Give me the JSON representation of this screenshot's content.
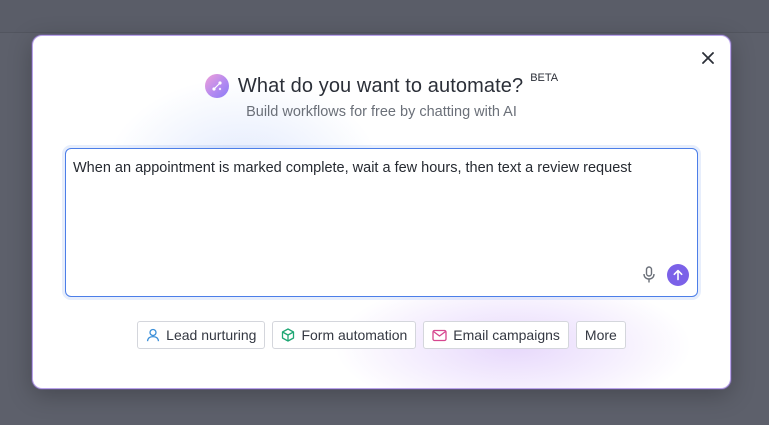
{
  "dialog": {
    "title": "What do you want to automate?",
    "badge": "BETA",
    "subtitle": "Build workflows for free by chatting with AI",
    "close_icon": "close-icon"
  },
  "prompt": {
    "value": "When an appointment is marked complete, wait a few hours, then text a review request",
    "mic_icon": "microphone-icon",
    "send_icon": "arrow-up-icon"
  },
  "suggestions": [
    {
      "label": "Lead nurturing",
      "icon": "user-icon",
      "color": "#3b8fd9"
    },
    {
      "label": "Form automation",
      "icon": "cube-icon",
      "color": "#1fa774"
    },
    {
      "label": "Email campaigns",
      "icon": "envelope-icon",
      "color": "#d6468f"
    },
    {
      "label": "More"
    }
  ],
  "colors": {
    "accent": "#7b61e8",
    "input_border": "#4c7ee8"
  }
}
